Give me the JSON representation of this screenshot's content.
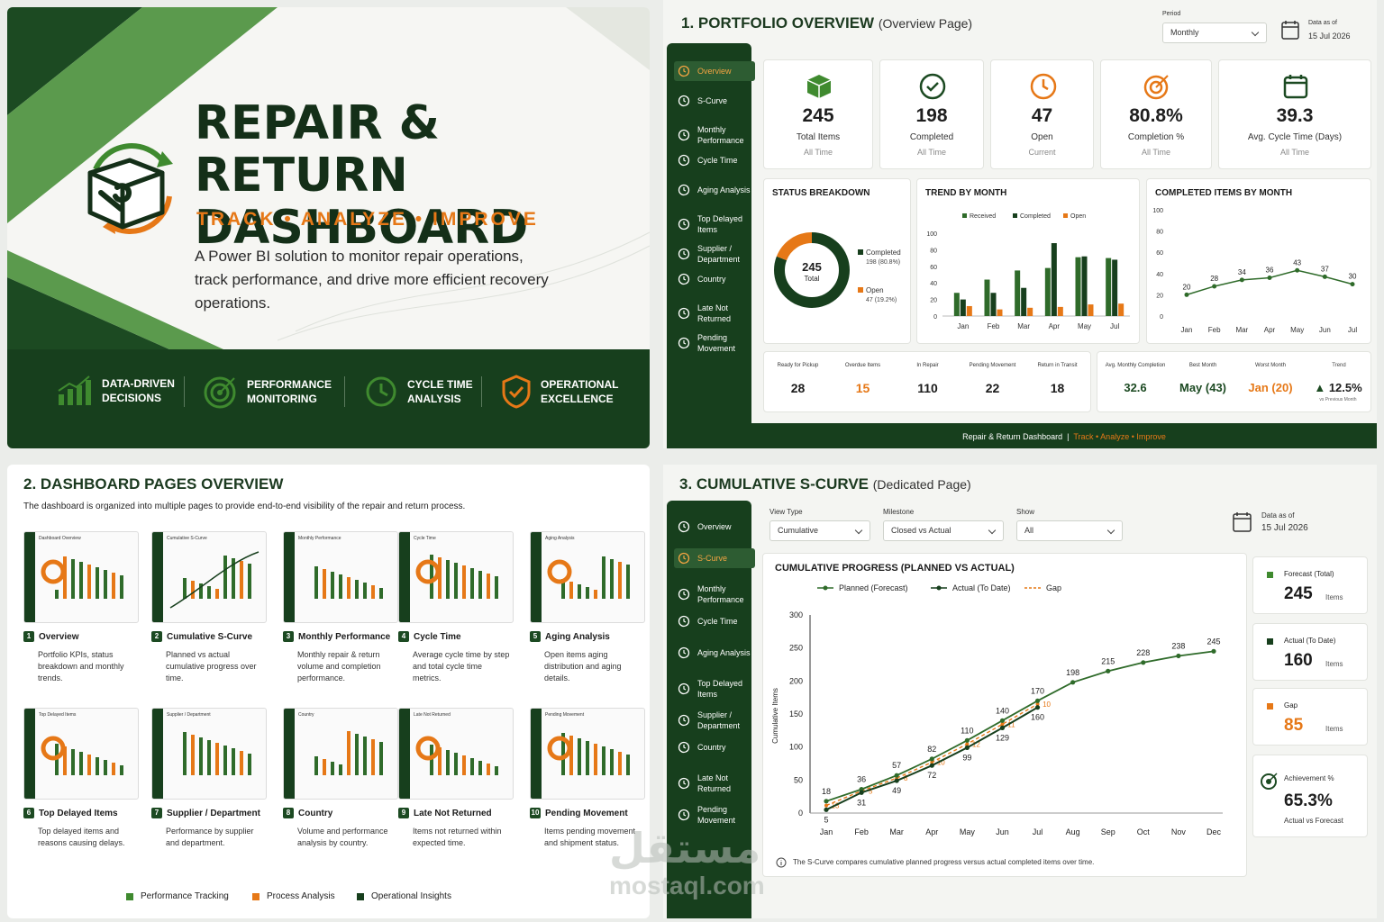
{
  "hero": {
    "title_line1": "REPAIR & RETURN",
    "title_line2": "DASHBOARD",
    "tagline": "TRACK • ANALYZE • IMPROVE",
    "description": "A Power BI solution to monitor repair operations, track performance, and drive more efficient recovery operations.",
    "features": [
      {
        "icon": "bar-chart-growth-icon",
        "line1": "DATA-DRIVEN",
        "line2": "DECISIONS"
      },
      {
        "icon": "target-icon",
        "line1": "PERFORMANCE",
        "line2": "MONITORING"
      },
      {
        "icon": "clock-cycle-icon",
        "line1": "CYCLE TIME",
        "line2": "ANALYSIS"
      },
      {
        "icon": "shield-check-icon",
        "line1": "OPERATIONAL",
        "line2": "EXCELLENCE"
      }
    ]
  },
  "portfolio": {
    "title": "1. PORTFOLIO OVERVIEW",
    "title_suffix": "(Overview Page)",
    "period_label": "Period",
    "period_value": "Monthly",
    "data_as_of_label": "Data as of",
    "data_as_of_value": "15 Jul 2026",
    "nav": [
      {
        "icon": "home-icon",
        "label": "Overview",
        "active": true
      },
      {
        "icon": "line-chart-icon",
        "label": "S-Curve"
      },
      {
        "icon": "gauge-icon",
        "label": "Monthly Performance"
      },
      {
        "icon": "clock-icon",
        "label": "Cycle Time"
      },
      {
        "icon": "magnifier-icon",
        "label": "Aging Analysis"
      },
      {
        "icon": "list-icon",
        "label": "Top Delayed Items"
      },
      {
        "icon": "people-icon",
        "label": "Supplier / Department"
      },
      {
        "icon": "globe-icon",
        "label": "Country"
      },
      {
        "icon": "return-icon",
        "label": "Late Not Returned"
      },
      {
        "icon": "box-icon",
        "label": "Pending Movement"
      }
    ],
    "kpis": [
      {
        "icon": "cube-icon",
        "value": "245",
        "label": "Total Items",
        "sub": "All Time"
      },
      {
        "icon": "check-circle-icon",
        "value": "198",
        "label": "Completed",
        "sub": "All Time"
      },
      {
        "icon": "clock-icon",
        "value": "47",
        "label": "Open",
        "sub": "Current"
      },
      {
        "icon": "target-icon",
        "value": "80.8%",
        "label": "Completion %",
        "sub": "All Time"
      },
      {
        "icon": "calendar-icon",
        "value": "39.3",
        "label": "Avg. Cycle Time (Days)",
        "sub": "All Time"
      }
    ],
    "status": {
      "title": "STATUS BREAKDOWN",
      "total_value": "245",
      "total_label": "Total",
      "completed_label": "Completed",
      "completed_detail": "198 (80.8%)",
      "open_label": "Open",
      "open_detail": "47 (19.2%)",
      "completed_share": 0.808
    },
    "strip1": [
      {
        "label": "Ready for Pickup",
        "value": "28",
        "highlight": false
      },
      {
        "label": "Overdue Items",
        "value": "15",
        "highlight": true
      },
      {
        "label": "In Repair",
        "value": "110",
        "highlight": false
      },
      {
        "label": "Pending Movement",
        "value": "22",
        "highlight": false
      },
      {
        "label": "Return in Transit",
        "value": "18",
        "highlight": false
      }
    ],
    "strip2": [
      {
        "label": "Avg. Monthly Completion",
        "value": "32.6",
        "highlight": false
      },
      {
        "label": "Best Month",
        "value": "May (43)",
        "highlight": false
      },
      {
        "label": "Worst Month",
        "value": "Jan (20)",
        "highlight": true
      }
    ],
    "trend_kpi": {
      "label": "Trend",
      "value": "12.5%",
      "sub": "vs Previous Month"
    },
    "footer_text": "Repair & Return Dashboard",
    "footer_tag": "Track • Analyze • Improve"
  },
  "chart_data": [
    {
      "type": "bar",
      "title": "TREND BY MONTH",
      "categories": [
        "Jan",
        "Feb",
        "Mar",
        "Apr",
        "May",
        "Jul"
      ],
      "ylim": [
        0,
        100
      ],
      "yticks": [
        0,
        20,
        40,
        60,
        80,
        100
      ],
      "series": [
        {
          "name": "Received",
          "color": "#2f6b2a",
          "values": [
            28,
            44,
            55,
            58,
            71,
            70
          ]
        },
        {
          "name": "Completed",
          "color": "#173f1d",
          "values": [
            20,
            28,
            34,
            88,
            72,
            68
          ]
        },
        {
          "name": "Open",
          "color": "#e67817",
          "values": [
            12,
            8,
            10,
            11,
            14,
            15
          ]
        }
      ]
    },
    {
      "type": "line",
      "title": "COMPLETED ITEMS BY MONTH",
      "categories": [
        "Jan",
        "Feb",
        "Mar",
        "Apr",
        "May",
        "Jun",
        "Jul"
      ],
      "ylim": [
        0,
        100
      ],
      "yticks": [
        0,
        20,
        40,
        60,
        80,
        100
      ],
      "series": [
        {
          "values": [
            20,
            28,
            34,
            36,
            43,
            37,
            30
          ]
        }
      ]
    },
    {
      "type": "line",
      "title": "CUMULATIVE PROGRESS (PLANNED VS ACTUAL)",
      "ylabel": "Cumulative Items",
      "categories": [
        "Jan",
        "Feb",
        "Mar",
        "Apr",
        "May",
        "Jun",
        "Jul",
        "Aug",
        "Sep",
        "Oct",
        "Nov",
        "Dec"
      ],
      "ylim": [
        0,
        300
      ],
      "yticks": [
        0,
        50,
        100,
        150,
        200,
        250,
        300
      ],
      "series": [
        {
          "name": "Planned (Forecast)",
          "color": "#2f6b2a",
          "values": [
            18,
            36,
            57,
            82,
            110,
            140,
            170,
            198,
            215,
            228,
            238,
            245
          ]
        },
        {
          "name": "Actual (To Date)",
          "color": "#173f1d",
          "values": [
            5,
            31,
            49,
            72,
            99,
            129,
            160
          ]
        },
        {
          "name": "Gap",
          "color": "#e67817",
          "values": [
            13,
            5,
            8,
            10,
            12,
            11,
            10
          ]
        }
      ]
    }
  ],
  "pages": {
    "title": "2. DASHBOARD PAGES OVERVIEW",
    "intro": "The dashboard is organized into multiple pages to provide end-to-end visibility of the repair and return process.",
    "items": [
      {
        "num": "1",
        "name": "Overview",
        "desc": "Portfolio KPIs, status breakdown and monthly trends.",
        "thumb_title": "Dashboard Overview"
      },
      {
        "num": "2",
        "name": "Cumulative S-Curve",
        "desc": "Planned vs actual cumulative progress over time.",
        "thumb_title": "Cumulative S-Curve"
      },
      {
        "num": "3",
        "name": "Monthly Performance",
        "desc": "Monthly repair & return volume and completion performance.",
        "thumb_title": "Monthly Performance"
      },
      {
        "num": "4",
        "name": "Cycle Time",
        "desc": "Average cycle time by step and total cycle time metrics.",
        "thumb_title": "Cycle Time"
      },
      {
        "num": "5",
        "name": "Aging Analysis",
        "desc": "Open items aging distribution and aging details.",
        "thumb_title": "Aging Analysis"
      },
      {
        "num": "6",
        "name": "Top Delayed Items",
        "desc": "Top delayed items and reasons causing delays.",
        "thumb_title": "Top Delayed Items"
      },
      {
        "num": "7",
        "name": "Supplier / Department",
        "desc": "Performance by supplier and department.",
        "thumb_title": "Supplier / Department"
      },
      {
        "num": "8",
        "name": "Country",
        "desc": "Volume and performance analysis by country.",
        "thumb_title": "Country"
      },
      {
        "num": "9",
        "name": "Late Not Returned",
        "desc": "Items not returned within expected time.",
        "thumb_title": "Late Not Returned"
      },
      {
        "num": "10",
        "name": "Pending Movement",
        "desc": "Items pending movement and shipment status.",
        "thumb_title": "Pending Movement"
      }
    ],
    "legend": [
      {
        "label": "Performance Tracking",
        "color": "#3f8a2f"
      },
      {
        "label": "Process Analysis",
        "color": "#e67817"
      },
      {
        "label": "Operational Insights",
        "color": "#173f1d"
      }
    ]
  },
  "scurve": {
    "title": "3. CUMULATIVE S-CURVE",
    "title_suffix": "(Dedicated Page)",
    "filters": [
      {
        "label": "View Type",
        "value": "Cumulative"
      },
      {
        "label": "Milestone",
        "value": "Closed vs Actual"
      },
      {
        "label": "Show",
        "value": "All"
      }
    ],
    "data_as_of_label": "Data as of",
    "data_as_of_value": "15 Jul 2026",
    "nav": [
      {
        "icon": "home-icon",
        "label": "Overview"
      },
      {
        "icon": "line-chart-icon",
        "label": "S-Curve",
        "active": true
      },
      {
        "icon": "gauge-icon",
        "label": "Monthly Performance"
      },
      {
        "icon": "clock-icon",
        "label": "Cycle Time"
      },
      {
        "icon": "magnifier-icon",
        "label": "Aging Analysis"
      },
      {
        "icon": "list-icon",
        "label": "Top Delayed Items"
      },
      {
        "icon": "people-icon",
        "label": "Supplier / Department"
      },
      {
        "icon": "globe-icon",
        "label": "Country"
      },
      {
        "icon": "return-icon",
        "label": "Late Not Returned"
      },
      {
        "icon": "box-icon",
        "label": "Pending Movement"
      }
    ],
    "side_kpis": [
      {
        "label": "Forecast (Total)",
        "value": "245",
        "unit": "Items",
        "color": "#3f8a2f"
      },
      {
        "label": "Actual (To Date)",
        "value": "160",
        "unit": "Items",
        "color": "#173f1d"
      },
      {
        "label": "Gap",
        "value": "85",
        "unit": "Items",
        "color": "#e67817"
      }
    ],
    "achievement": {
      "label": "Achievement %",
      "value": "65.3%",
      "sub": "Actual vs Forecast"
    },
    "note": "The S-Curve compares cumulative planned progress versus actual completed items over time."
  },
  "watermark": {
    "arabic": "مستقل",
    "latin": "mostaql.com"
  }
}
